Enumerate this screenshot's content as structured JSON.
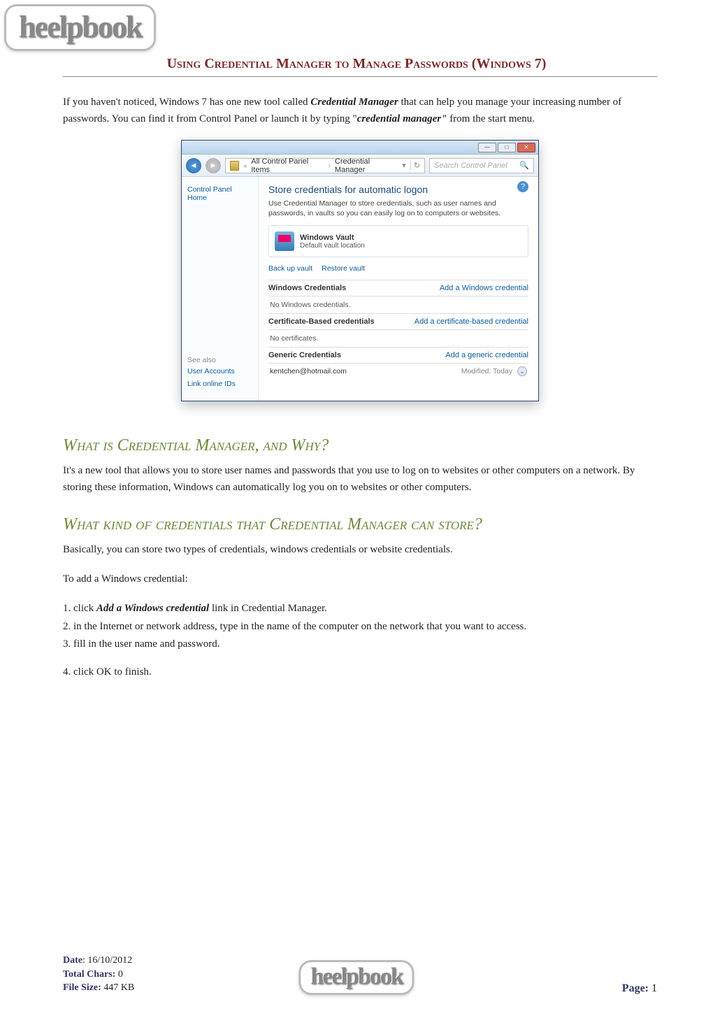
{
  "logo_text": "heelpbook",
  "title": "Using Credential Manager to Manage Passwords (Windows 7)",
  "intro": {
    "pre": "If you haven't noticed, Windows 7 has one new tool called ",
    "em1": "Credential Manager",
    "mid": " that can help you manage your increasing number of passwords. You can find it from Control Panel or launch it by typing \"",
    "em2": "credential manager\"",
    "post": " from the start menu."
  },
  "screenshot": {
    "breadcrumb": {
      "item1": "All Control Panel Items",
      "item2": "Credential Manager"
    },
    "search_placeholder": "Search Control Panel",
    "sidebar_top": "Control Panel Home",
    "sidebar_see_also": "See also",
    "sidebar_links": [
      "User Accounts",
      "Link online IDs"
    ],
    "main_heading": "Store credentials for automatic logon",
    "main_desc": "Use Credential Manager to store credentials, such as user names and passwords, in vaults so you can easily log on to computers or websites.",
    "vault_name": "Windows Vault",
    "vault_loc": "Default vault location",
    "backup": "Back up vault",
    "restore": "Restore vault",
    "win_cred_head": "Windows Credentials",
    "add_win_cred": "Add a Windows credential",
    "no_win_cred": "No Windows credentials.",
    "cert_head": "Certificate-Based credentials",
    "add_cert": "Add a certificate-based credential",
    "no_cert": "No certificates.",
    "gen_head": "Generic Credentials",
    "add_gen": "Add a generic credential",
    "gen_entry": "kentchen@hotmail.com",
    "gen_mod": "Modified: Today"
  },
  "section1": {
    "heading": "What is Credential Manager, and Why?",
    "body": "It's a new tool that allows you to store user names and passwords that you use to log on to websites or other computers on a network. By storing these information, Windows can automatically log you on to websites or other computers."
  },
  "section2": {
    "heading": "What kind of credentials that Credential Manager can store?",
    "body": "Basically, you can store two types of credentials, windows credentials or website credentials.",
    "lead": "To add a Windows credential:",
    "step1_pre": "1. click ",
    "step1_em": "Add a Windows credential",
    "step1_post": " link in Credential Manager.",
    "step2": "2. in the Internet or network address, type in the name of the computer on the network that you want to access.",
    "step3": "3. fill in the user name and password.",
    "step4": "4. click OK to finish."
  },
  "footer": {
    "date_label": "Date",
    "date_value": ": 16/10/2012",
    "chars_label": "Total Chars:",
    "chars_value": " 0",
    "size_label": "File Size:",
    "size_value": " 447 KB",
    "page_label": "Page:",
    "page_value": " 1"
  }
}
